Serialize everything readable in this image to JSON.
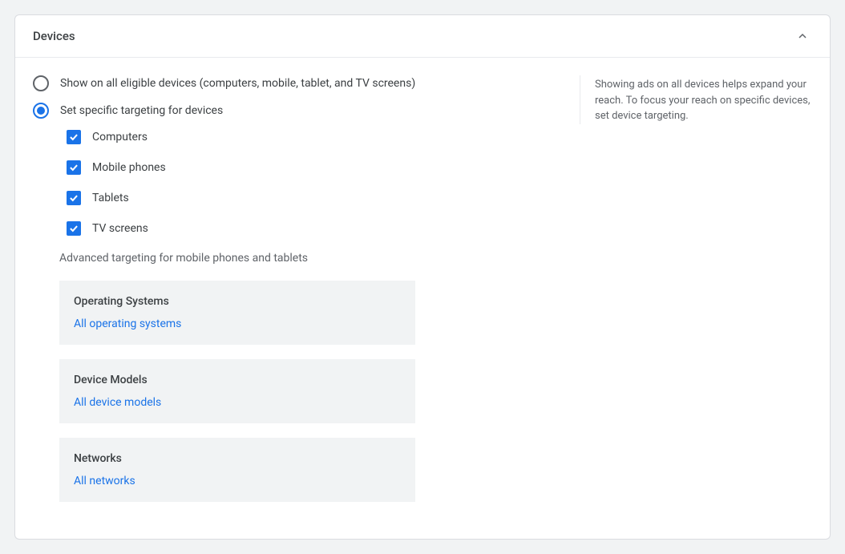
{
  "panel": {
    "title": "Devices"
  },
  "radios": {
    "all": "Show on all eligible devices (computers, mobile, tablet, and TV screens)",
    "specific": "Set specific targeting for devices"
  },
  "devices": [
    "Computers",
    "Mobile phones",
    "Tablets",
    "TV screens"
  ],
  "advanced_heading": "Advanced targeting for mobile phones and tablets",
  "advanced": [
    {
      "title": "Operating Systems",
      "link": "All operating systems"
    },
    {
      "title": "Device Models",
      "link": "All device models"
    },
    {
      "title": "Networks",
      "link": "All networks"
    }
  ],
  "help_text": "Showing ads on all devices helps expand your reach. To focus your reach on specific devices, set device targeting."
}
